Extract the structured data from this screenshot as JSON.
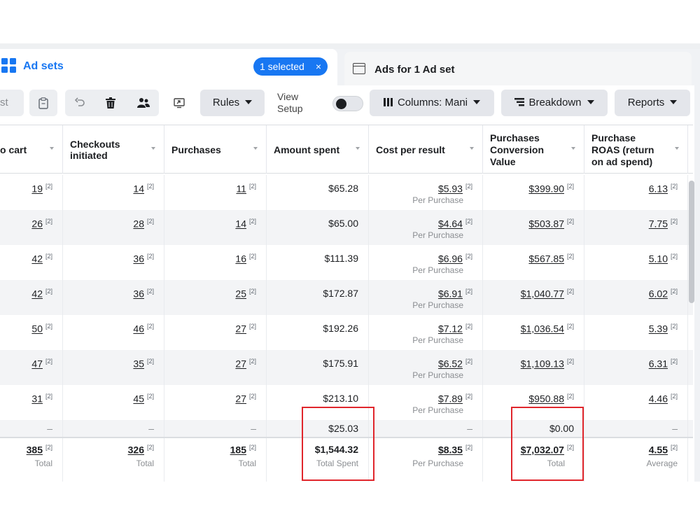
{
  "tabs": {
    "adsets_label": "Ad sets",
    "selected_label": "1 selected",
    "selected_close": "×",
    "ads_label": "Ads for 1 Ad set"
  },
  "toolbar": {
    "test_label": "st",
    "rules_label": "Rules",
    "view_setup_line1": "View",
    "view_setup_line2": "Setup",
    "columns_label": "Columns: Mani",
    "breakdown_label": "Breakdown",
    "reports_label": "Reports"
  },
  "columns": [
    {
      "line1": "o cart",
      "line2": "",
      "line3": ""
    },
    {
      "line1": "Checkouts",
      "line2": "initiated",
      "line3": ""
    },
    {
      "line1": "Purchases",
      "line2": "",
      "line3": ""
    },
    {
      "line1": "Amount spent",
      "line2": "",
      "line3": ""
    },
    {
      "line1": "Cost per result",
      "line2": "",
      "line3": ""
    },
    {
      "line1": "Purchases",
      "line2": "Conversion",
      "line3": "Value"
    },
    {
      "line1": "Purchase",
      "line2": "ROAS (return",
      "line3": "on ad spend)"
    }
  ],
  "footnote_marker": "[2]",
  "cost_subtext": "Per Purchase",
  "rows": [
    {
      "cart": "19",
      "checkouts": "14",
      "purchases": "11",
      "spent": "$65.28",
      "cost": "$5.93",
      "value": "$399.90",
      "roas": "6.13"
    },
    {
      "cart": "26",
      "checkouts": "28",
      "purchases": "14",
      "spent": "$65.00",
      "cost": "$4.64",
      "value": "$503.87",
      "roas": "7.75"
    },
    {
      "cart": "42",
      "checkouts": "36",
      "purchases": "16",
      "spent": "$111.39",
      "cost": "$6.96",
      "value": "$567.85",
      "roas": "5.10"
    },
    {
      "cart": "42",
      "checkouts": "36",
      "purchases": "25",
      "spent": "$172.87",
      "cost": "$6.91",
      "value": "$1,040.77",
      "roas": "6.02"
    },
    {
      "cart": "50",
      "checkouts": "46",
      "purchases": "27",
      "spent": "$192.26",
      "cost": "$7.12",
      "value": "$1,036.54",
      "roas": "5.39"
    },
    {
      "cart": "47",
      "checkouts": "35",
      "purchases": "27",
      "spent": "$175.91",
      "cost": "$6.52",
      "value": "$1,109.13",
      "roas": "6.31"
    },
    {
      "cart": "31",
      "checkouts": "45",
      "purchases": "27",
      "spent": "$213.10",
      "cost": "$7.89",
      "value": "$950.88",
      "roas": "4.46"
    }
  ],
  "extra_row": {
    "dash": "–",
    "spent": "$25.03",
    "value": "$0.00"
  },
  "totals": {
    "cart": "385",
    "cart_sub": "Total",
    "checkouts": "326",
    "checkouts_sub": "Total",
    "purchases": "185",
    "purchases_sub": "Total",
    "spent": "$1,544.32",
    "spent_sub": "Total Spent",
    "cost": "$8.35",
    "cost_sub": "Per Purchase",
    "value": "$7,032.07",
    "value_sub": "Total",
    "roas": "4.55",
    "roas_sub": "Average"
  },
  "colors": {
    "accent": "#1877f2",
    "highlight": "#e0262c",
    "row_alt": "#f3f4f6"
  },
  "icons": [
    "grid-icon",
    "ads-window-icon",
    "clipboard-icon",
    "undo-icon",
    "trash-icon",
    "users-icon",
    "export-icon",
    "columns-icon",
    "breakdown-icon",
    "caret-down-icon",
    "sort-icon"
  ]
}
